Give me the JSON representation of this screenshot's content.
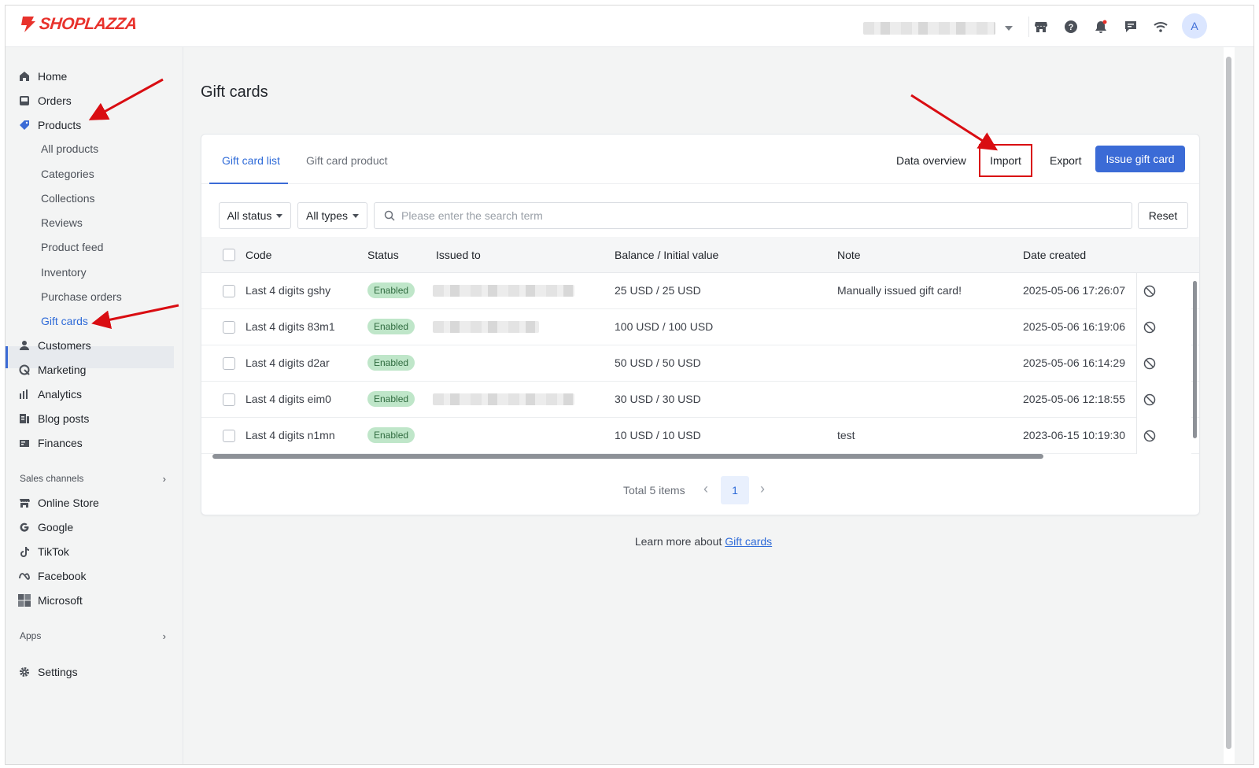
{
  "brand": {
    "logo_text": "SHOPLAZZA",
    "brand_color": "#e8322c"
  },
  "topbar": {
    "avatar_letter": "A",
    "icons": [
      "store-icon",
      "help-icon",
      "bell-icon",
      "chat-icon",
      "wifi-icon"
    ]
  },
  "sidebar": {
    "items": [
      {
        "label": "Home",
        "icon": "home-icon"
      },
      {
        "label": "Orders",
        "icon": "orders-icon"
      },
      {
        "label": "Products",
        "icon": "tag-icon"
      }
    ],
    "product_sub": [
      "All products",
      "Categories",
      "Collections",
      "Reviews",
      "Product feed",
      "Inventory",
      "Purchase orders",
      "Gift cards"
    ],
    "items_after": [
      {
        "label": "Customers",
        "icon": "person-icon"
      },
      {
        "label": "Marketing",
        "icon": "marketing-icon"
      },
      {
        "label": "Analytics",
        "icon": "analytics-icon"
      },
      {
        "label": "Blog posts",
        "icon": "blog-icon"
      },
      {
        "label": "Finances",
        "icon": "finances-icon"
      }
    ],
    "sales_channels_label": "Sales channels",
    "channels": [
      {
        "label": "Online Store",
        "icon": "store-icon"
      },
      {
        "label": "Google",
        "icon": "google-icon"
      },
      {
        "label": "TikTok",
        "icon": "tiktok-icon"
      },
      {
        "label": "Facebook",
        "icon": "meta-icon"
      },
      {
        "label": "Microsoft",
        "icon": "microsoft-icon"
      }
    ],
    "apps_label": "Apps",
    "settings_label": "Settings"
  },
  "page": {
    "title": "Gift cards",
    "tabs": [
      "Gift card list",
      "Gift card product"
    ],
    "actions": {
      "data_overview": "Data overview",
      "import": "Import",
      "export": "Export",
      "issue": "Issue gift card"
    },
    "filters": {
      "status": "All status",
      "types": "All types",
      "search_placeholder": "Please enter the search term",
      "reset": "Reset"
    },
    "columns": [
      "Code",
      "Status",
      "Issued to",
      "Balance / Initial value",
      "Note",
      "Date created"
    ],
    "rows": [
      {
        "code": "Last 4 digits gshy",
        "status": "Enabled",
        "balance": "25 USD / 25 USD",
        "note": "Manually issued gift card!",
        "date": "2025-05-06 17:26:07"
      },
      {
        "code": "Last 4 digits 83m1",
        "status": "Enabled",
        "balance": "100 USD / 100 USD",
        "note": "",
        "date": "2025-05-06 16:19:06"
      },
      {
        "code": "Last 4 digits d2ar",
        "status": "Enabled",
        "balance": "50 USD / 50 USD",
        "note": "",
        "date": "2025-05-06 16:14:29"
      },
      {
        "code": "Last 4 digits eim0",
        "status": "Enabled",
        "balance": "30 USD / 30 USD",
        "note": "",
        "date": "2025-05-06 12:18:55"
      },
      {
        "code": "Last 4 digits n1mn",
        "status": "Enabled",
        "balance": "10 USD / 10 USD",
        "note": "test",
        "date": "2023-06-15 10:19:30"
      }
    ],
    "pagination": {
      "total": "Total 5 items",
      "current": "1"
    },
    "learn_more": {
      "prefix": "Learn more about ",
      "link": "Gift cards"
    }
  },
  "colors": {
    "accent": "#3b6bd6",
    "annotation": "#d90d12",
    "badge_bg": "#bfe6c9"
  }
}
